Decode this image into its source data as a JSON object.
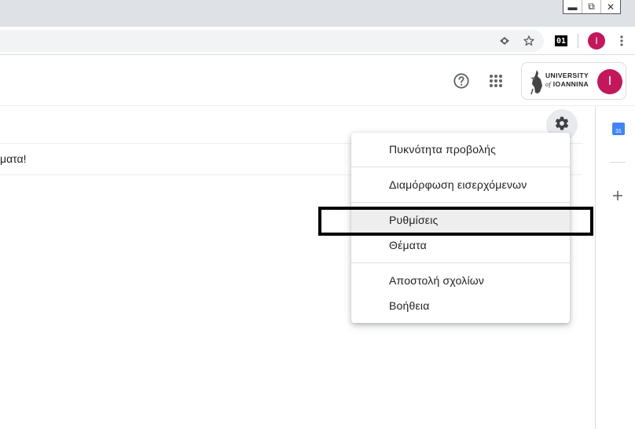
{
  "browser": {
    "window_controls": [
      "minimize",
      "restore",
      "close"
    ],
    "toolbar_icons": [
      "eye-icon",
      "star-icon"
    ],
    "extension_label": "01",
    "profile_initial": "I"
  },
  "header": {
    "university_line1": "UNIVERSITY",
    "university_of": "of",
    "university_line2": "IOANNINA",
    "avatar_initial": "I"
  },
  "content": {
    "message_fragment": "ματα!"
  },
  "side_panel": {
    "calendar_number": "31"
  },
  "settings_menu": {
    "items": [
      {
        "label": "Πυκνότητα προβολής"
      },
      {
        "label": "Διαμόρφωση εισερχόμενων"
      },
      {
        "label": "Ρυθμίσεις"
      },
      {
        "label": "Θέματα"
      },
      {
        "label": "Αποστολή σχολίων"
      },
      {
        "label": "Βοήθεια"
      }
    ],
    "highlighted_index": 2
  },
  "colors": {
    "avatar": "#c2185b",
    "calendar": "#4285f4",
    "highlight_frame": "#000000"
  }
}
